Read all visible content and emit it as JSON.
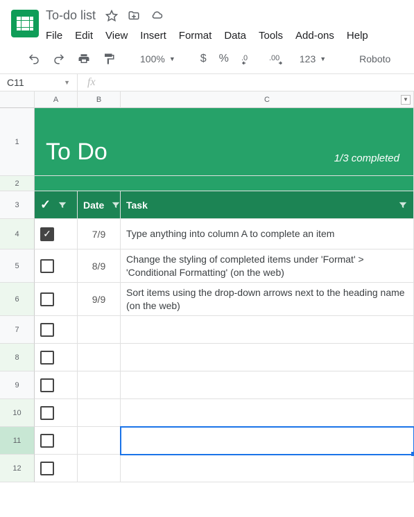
{
  "doc": {
    "title": "To-do list"
  },
  "menu": {
    "file": "File",
    "edit": "Edit",
    "view": "View",
    "insert": "Insert",
    "format": "Format",
    "data": "Data",
    "tools": "Tools",
    "addons": "Add-ons",
    "help": "Help"
  },
  "toolbar": {
    "zoom": "100%",
    "currency": "$",
    "percent": "%",
    "dec_dec": ".0",
    "dec_inc": ".00",
    "numfmt": "123",
    "font": "Roboto"
  },
  "namebox": "C11",
  "cols": {
    "a": "A",
    "b": "B",
    "c": "C"
  },
  "rows": [
    "1",
    "2",
    "3",
    "4",
    "5",
    "6",
    "7",
    "8",
    "9",
    "10",
    "11",
    "12"
  ],
  "hero": {
    "title": "To Do",
    "completed": "1/3 completed"
  },
  "headings": {
    "check": "✓",
    "date": "Date",
    "task": "Task"
  },
  "items": [
    {
      "checked": true,
      "date": "7/9",
      "task": "Type anything into column A to complete an item"
    },
    {
      "checked": false,
      "date": "8/9",
      "task": "Change the styling of completed items under 'Format' > 'Conditional Formatting' (on the web)"
    },
    {
      "checked": false,
      "date": "9/9",
      "task": "Sort items using the drop-down arrows next to the heading name (on the web)"
    }
  ]
}
